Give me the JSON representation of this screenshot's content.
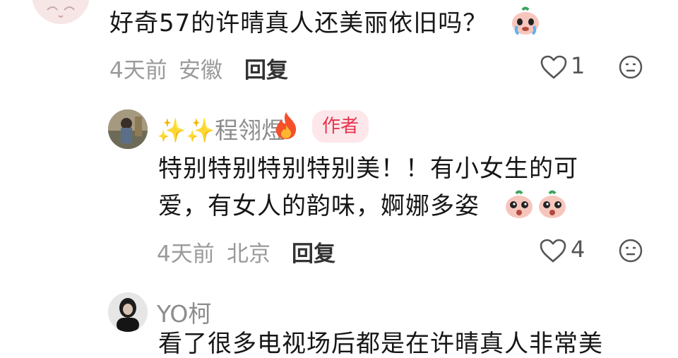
{
  "comments": [
    {
      "text": "好奇57的许晴真人还美丽依旧吗？",
      "time": "4天前",
      "location": "安徽",
      "reply_label": "回复",
      "likes": "1",
      "emoji": "crying-face-emoji"
    },
    {
      "author": "✨✨程翎煜",
      "author_flair": "fire-emoji",
      "badge": "作者",
      "line1": "特别特别特别特别美！！有小女生的可",
      "line2": "爱，有女人的韵味，婀娜多姿",
      "time": "4天前",
      "location": "北京",
      "reply_label": "回复",
      "likes": "4"
    },
    {
      "author": "YO柯",
      "partial_text": "看了很多电视场后都是在许晴真人非常美"
    }
  ]
}
